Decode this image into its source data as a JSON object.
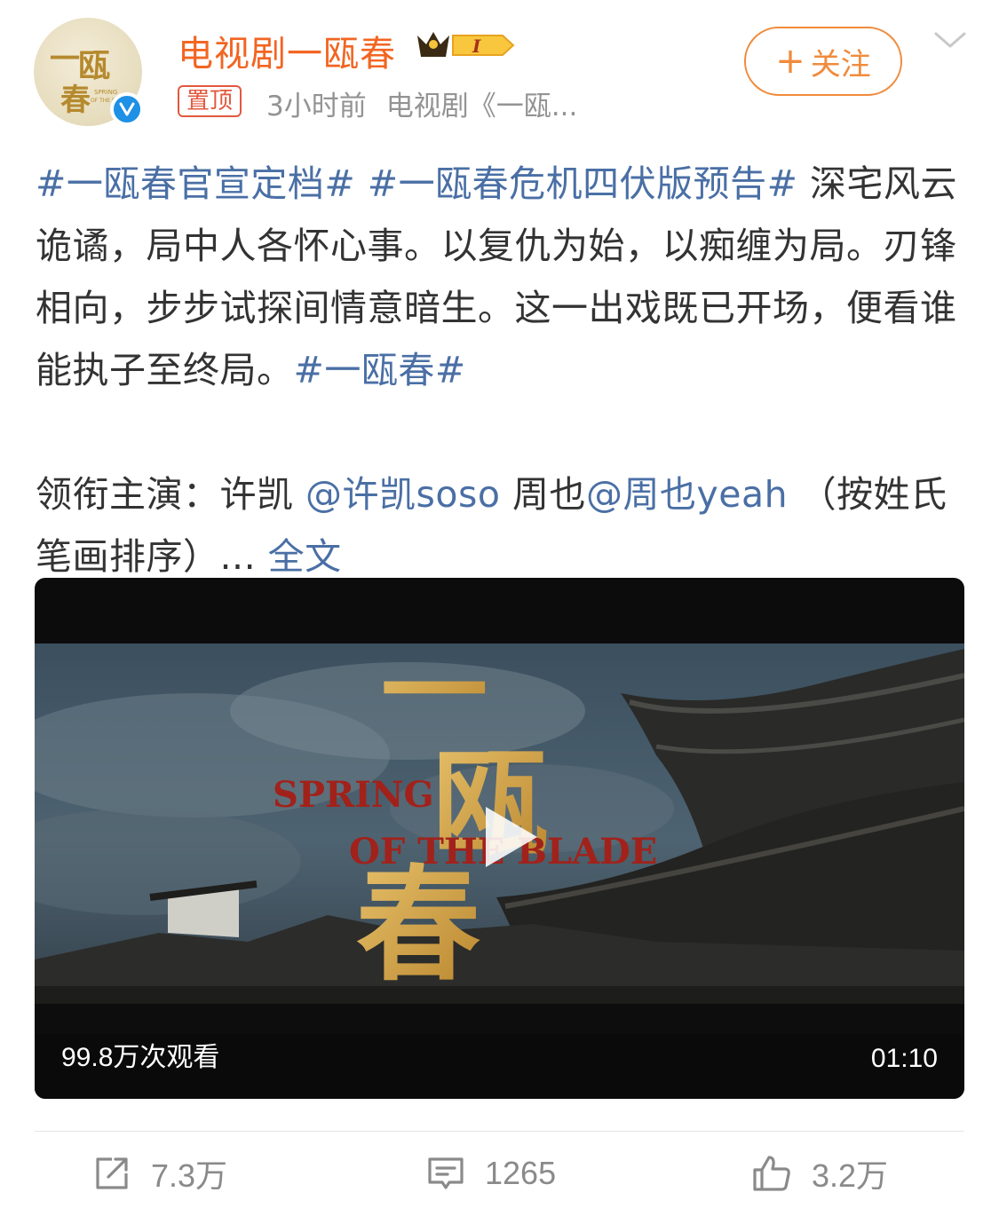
{
  "header": {
    "user_name": "电视剧一瓯春",
    "vip_level": "I",
    "pin_label": "置顶",
    "time": "3小时前",
    "source": "电视剧《一瓯...",
    "follow_label": "关注",
    "avatar_text": "一瓯春",
    "avatar_sub": "SPRING OF THE BLADE"
  },
  "post": {
    "topic1": "#一瓯春官宣定档#",
    "topic2": "#一瓯春危机四伏版预告#",
    "text1": "深宅风云诡谲，局中人各怀心事。以复仇为始，以痴缠为局。刃锋相向，步步试探间情意暗生。这一出戏既已开场，便看谁能执子至终局。",
    "topic3": "#一瓯春#",
    "cast_prefix": "领衔主演：许凯",
    "mention1": "@许凯soso",
    "cast_mid": "周也",
    "mention2": "@周也yeah",
    "cast_suffix": "（按姓氏笔画排序）...",
    "full_text_link": "全文"
  },
  "video": {
    "title_cn_1": "一",
    "title_cn_2": "瓯",
    "title_cn_3": "春",
    "title_en_1": "SPRING",
    "title_en_2": "OF THE BLADE",
    "views": "99.8万次观看",
    "duration": "01:10"
  },
  "actions": {
    "repost_count": "7.3万",
    "comment_count": "1265",
    "like_count": "3.2万"
  },
  "colors": {
    "username": "#f26522",
    "link": "#4a6fa5",
    "follow": "#f08b3c",
    "pin": "#e2583e",
    "verified": "#1e90e6"
  }
}
